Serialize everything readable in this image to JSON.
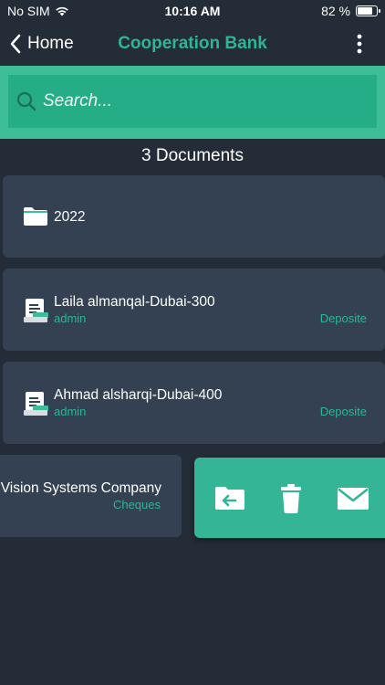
{
  "status_bar": {
    "carrier": "No SIM",
    "time": "10:16 AM",
    "battery_text": "82 %",
    "battery_level": 0.82
  },
  "nav": {
    "back_label": "Home",
    "title": "Cooperation Bank"
  },
  "search": {
    "placeholder": "Search...",
    "value": ""
  },
  "document_count": "3  Documents",
  "folder": {
    "name": "2022"
  },
  "documents": [
    {
      "title": "Laila almanqal-Dubai-300",
      "owner": "admin",
      "type": "Deposite"
    },
    {
      "title": "Ahmad alsharqi-Dubai-400",
      "owner": "admin",
      "type": "Deposite"
    },
    {
      "title": "Vision Systems Company",
      "type": "Cheques"
    }
  ],
  "icons": {
    "back": "chevron-left-icon",
    "more": "more-vertical-icon",
    "search": "search-icon",
    "folder": "folder-icon",
    "document": "document-icon",
    "move": "folder-move-icon",
    "delete": "trash-icon",
    "email": "envelope-icon"
  },
  "colors": {
    "background": "#232c37",
    "accent": "#2fb595",
    "card": "#334152",
    "search_band": "#3fbd98"
  }
}
